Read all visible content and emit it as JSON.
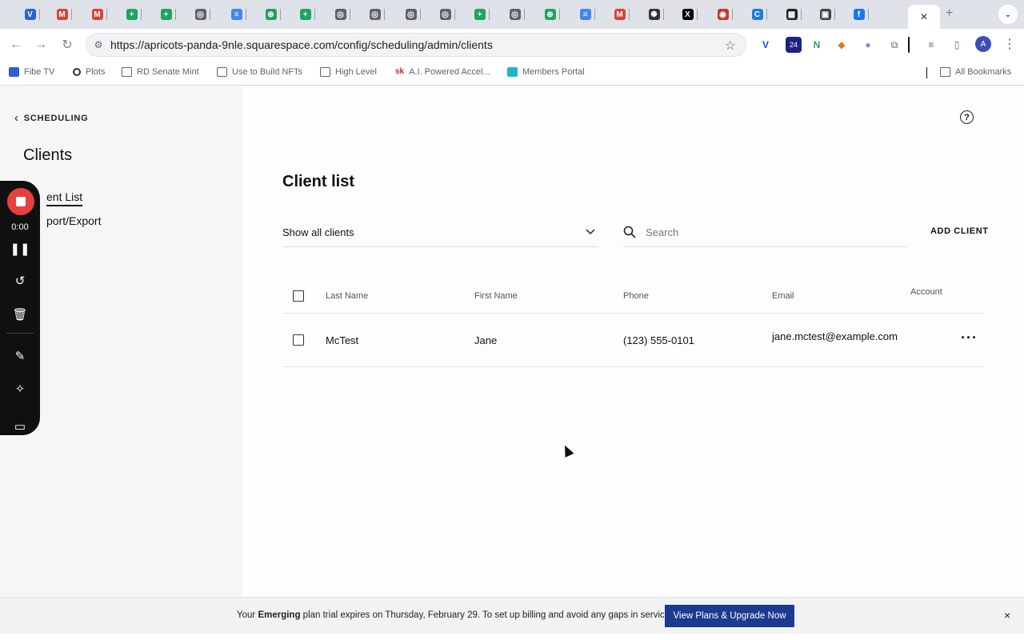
{
  "browser": {
    "tabs": [
      {
        "icon": "vivaldi-icon",
        "color": "#2b5fd8",
        "glyph": "V"
      },
      {
        "icon": "gmail-icon",
        "color": "#d44638",
        "glyph": "M"
      },
      {
        "icon": "gmail-icon",
        "color": "#d44638",
        "glyph": "M"
      },
      {
        "icon": "sheets-icon",
        "color": "#1ea362",
        "glyph": "+"
      },
      {
        "icon": "sheets-icon",
        "color": "#1ea362",
        "glyph": "+"
      },
      {
        "icon": "globe-icon",
        "color": "#5f6368",
        "glyph": "◎"
      },
      {
        "icon": "docs-icon",
        "color": "#4285f4",
        "glyph": "≡"
      },
      {
        "icon": "add-circle-icon",
        "color": "#1ea362",
        "glyph": "⊕"
      },
      {
        "icon": "sheets-icon",
        "color": "#1ea362",
        "glyph": "+"
      },
      {
        "icon": "globe-icon",
        "color": "#5f6368",
        "glyph": "◎"
      },
      {
        "icon": "globe-icon",
        "color": "#5f6368",
        "glyph": "◎"
      },
      {
        "icon": "globe-icon",
        "color": "#5f6368",
        "glyph": "◎"
      },
      {
        "icon": "globe-icon",
        "color": "#5f6368",
        "glyph": "◎"
      },
      {
        "icon": "sheets-icon",
        "color": "#1ea362",
        "glyph": "+"
      },
      {
        "icon": "globe-icon",
        "color": "#5f6368",
        "glyph": "◎"
      },
      {
        "icon": "add-circle-icon",
        "color": "#1ea362",
        "glyph": "⊕"
      },
      {
        "icon": "docs-icon",
        "color": "#4285f4",
        "glyph": "≡"
      },
      {
        "icon": "gmail-icon",
        "color": "#d44638",
        "glyph": "M"
      },
      {
        "icon": "openai-icon",
        "color": "#333333",
        "glyph": "✺"
      },
      {
        "icon": "x-icon",
        "color": "#000000",
        "glyph": "X"
      },
      {
        "icon": "record-icon",
        "color": "#c0392b",
        "glyph": "◉"
      },
      {
        "icon": "canva-icon",
        "color": "#1f7ae0",
        "glyph": "C"
      },
      {
        "icon": "app-icon",
        "color": "#222222",
        "glyph": "▦"
      },
      {
        "icon": "app-icon",
        "color": "#444444",
        "glyph": "▣"
      },
      {
        "icon": "facebook-icon",
        "color": "#1877f2",
        "glyph": "f"
      }
    ],
    "url": "https://apricots-panda-9nle.squarespace.com/config/scheduling/admin/clients",
    "profile_initial": "A",
    "ext_badge": "24",
    "bookmarks": [
      {
        "label": "Fibe TV",
        "icon": "fibe-icon"
      },
      {
        "label": "Plots",
        "icon": "plots-icon"
      },
      {
        "label": "RD Senate Mint",
        "icon": "folder-icon"
      },
      {
        "label": "Use to Build NFTs",
        "icon": "folder-icon"
      },
      {
        "label": "High Level",
        "icon": "folder-icon"
      },
      {
        "label": "A.I. Powered Accel...",
        "icon": "sk-icon"
      },
      {
        "label": "Members Portal",
        "icon": "tr-icon"
      }
    ],
    "all_bookmarks": "All Bookmarks"
  },
  "sidebar": {
    "back_label": "SCHEDULING",
    "title": "Clients",
    "items": [
      {
        "label": "ent List"
      },
      {
        "label": "port/Export"
      }
    ]
  },
  "recorder": {
    "time": "0:00"
  },
  "main": {
    "title": "Client list",
    "filter_value": "Show all clients",
    "search_placeholder": "Search",
    "add_client": "ADD CLIENT",
    "columns": [
      "Last Name",
      "First Name",
      "Phone",
      "Email",
      "Account"
    ],
    "rows": [
      {
        "last": "McTest",
        "first": "Jane",
        "phone": "(123) 555-0101",
        "email": "jane.mctest@example.com"
      }
    ]
  },
  "banner": {
    "prefix": "Your ",
    "plan": "Emerging",
    "suffix": " plan trial expires on Thursday, February 29.  To set up billing and avoid any gaps in service",
    "button": "View Plans & Upgrade Now",
    "close": "×"
  }
}
